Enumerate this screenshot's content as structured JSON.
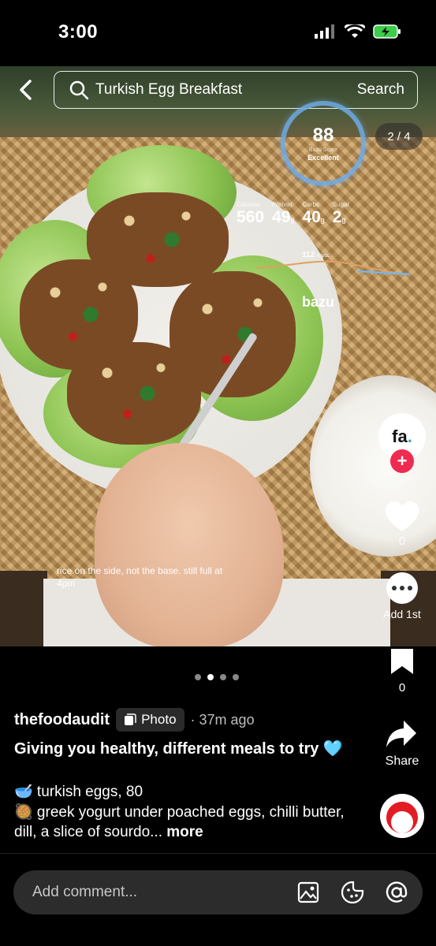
{
  "status_bar": {
    "time": "3:00"
  },
  "search": {
    "query": "Turkish Egg Breakfast",
    "button_label": "Search"
  },
  "bazu": {
    "score": "88",
    "score_label": "Bazu Score",
    "score_grade": "Excellent",
    "macros": [
      {
        "label": "Calories",
        "value": "560",
        "unit": ""
      },
      {
        "label": "Protein",
        "value": "49",
        "unit": "g"
      },
      {
        "label": "Carbs",
        "value": "40",
        "unit": "g"
      },
      {
        "label": "Sugar",
        "value": "2",
        "unit": "g"
      }
    ],
    "glucose_value": "112",
    "glucose_unit": "mg/dL",
    "logo_text": "bazu"
  },
  "carousel": {
    "counter": "2 / 4",
    "total": 4,
    "active_index": 1
  },
  "photo_caption": "rice on the side, not the base. still full at 4pm",
  "actions": {
    "avatar_text": "fa",
    "avatar_dot": ".",
    "follow_symbol": "+",
    "like_count": "0",
    "comment_label": "Add 1st",
    "bookmark_count": "0",
    "share_label": "Share"
  },
  "post": {
    "username": "thefoodaudit",
    "badge_label": "Photo",
    "timestamp": "· 37m ago",
    "title": "Giving you healthy, different meals to try 🩵",
    "line1": "🥣 turkish eggs, 80",
    "line2": "🥘 greek yogurt under poached eggs, chilli butter, dill, a slice of sourdo...",
    "more_label": "more"
  },
  "comment_bar": {
    "placeholder": "Add comment..."
  },
  "colors": {
    "accent_red": "#ef2b50",
    "score_ring": "#6eaae6",
    "glucose_line": "#e0a060"
  }
}
